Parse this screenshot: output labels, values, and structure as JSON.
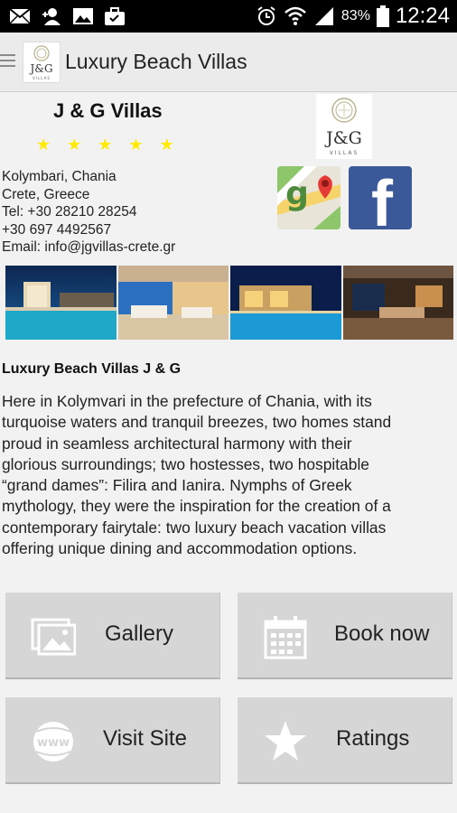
{
  "status_bar": {
    "battery": "83%",
    "time": "12:24",
    "icons": [
      "mail-icon",
      "add-contact-icon",
      "image-icon",
      "briefcase-icon",
      "alarm-icon",
      "wifi-icon",
      "signal-icon",
      "battery-icon"
    ]
  },
  "action_bar": {
    "title": "Luxury Beach Villas",
    "logo_text": "J&G",
    "logo_sub": "VILLAS"
  },
  "hotel": {
    "name": "J & G Villas",
    "rating_stars": 5,
    "star_glyph": "★",
    "logo_text": "J&G",
    "logo_sub": "VILLAS",
    "address_line1": "Kolymbari, Chania",
    "address_line2": "Crete, Greece",
    "tel": "Tel: +30 28210 28254",
    "mobile": "+30 697 4492567",
    "email": "Email: info@jgvillas-crete.gr"
  },
  "social": {
    "maps_icon": "google-maps-icon",
    "facebook_glyph": "f"
  },
  "description": {
    "title": "Luxury Beach Villas J & G",
    "line1": "Here in Kolymvari in the prefecture of Chania, with its",
    "line2": "turquoise waters and tranquil breezes, two homes stand",
    "line3": "proud in seamless architectural harmony with their",
    "line4": "glorious surroundings; two hostesses, two hospitable",
    "line5": "“grand dames”: Filira and Ianira. Nymphs of Greek",
    "line6": "mythology, they were the inspiration for the creation of a",
    "line7": "contemporary fairytale: two luxury beach vacation villas",
    "line8": "offering unique dining and accommodation options."
  },
  "buttons": {
    "gallery": "Gallery",
    "book": "Book now",
    "site": "Visit Site",
    "ratings": "Ratings"
  },
  "colors": {
    "star": "#ffea00",
    "facebook": "#3b5998",
    "button_bg": "#d6d6d6",
    "status_bar": "#000000"
  }
}
